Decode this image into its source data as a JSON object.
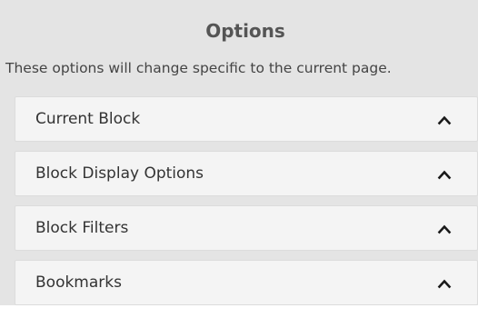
{
  "options": {
    "title": "Options",
    "description": "These options will change specific to the current page.",
    "items": [
      {
        "label": "Current Block",
        "icon": "chevron-up-icon"
      },
      {
        "label": "Block Display Options",
        "icon": "chevron-up-icon"
      },
      {
        "label": "Block Filters",
        "icon": "chevron-up-icon"
      },
      {
        "label": "Bookmarks",
        "icon": "chevron-up-icon"
      }
    ]
  }
}
